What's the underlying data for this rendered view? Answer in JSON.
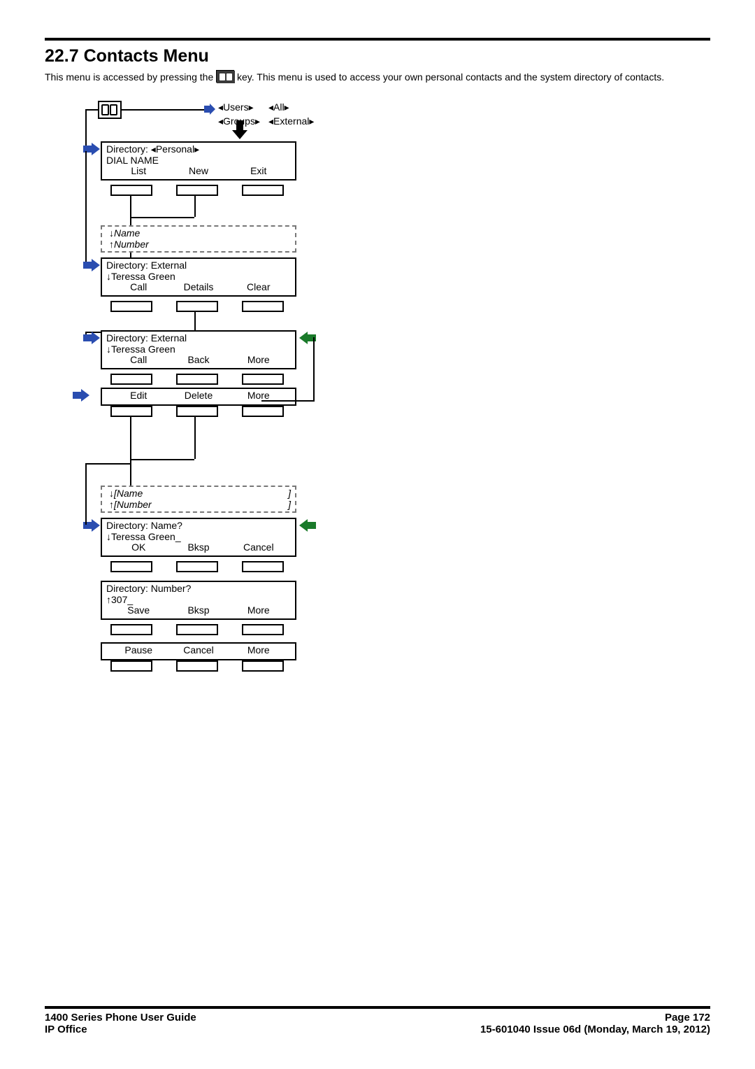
{
  "heading": "22.7 Contacts Menu",
  "intro_before": "This menu is accessed by pressing the ",
  "intro_after": " key. This menu is used to access your own personal contacts and the system directory of contacts.",
  "filters": {
    "users": "◂Users▸",
    "all": "◂All▸",
    "groups": "◂Groups▸",
    "external": "◂External▸"
  },
  "screen1": {
    "title": "Directory: ◂Personal▸",
    "line": "DIAL NAME",
    "soft": [
      "List",
      "New",
      "Exit"
    ]
  },
  "namebox1": {
    "name": "↓Name",
    "number": "↑Number"
  },
  "screen2": {
    "title": "Directory:  External",
    "line": "↓Teressa Green",
    "soft": [
      "Call",
      "Details",
      "Clear"
    ]
  },
  "screen3": {
    "title": "Directory:  External",
    "line": "↓Teressa Green",
    "soft": [
      "Call",
      "Back",
      "More"
    ]
  },
  "screen3b_soft": [
    "Edit",
    "Delete",
    "More"
  ],
  "namebox2": {
    "name": "↓[Name",
    "name_end": "]",
    "number": "↑[Number",
    "number_end": "]"
  },
  "screen4": {
    "title": "Directory: Name?",
    "line": "↓Teressa Green_",
    "soft": [
      "OK",
      "Bksp",
      "Cancel"
    ]
  },
  "screen5": {
    "title": "Directory: Number?",
    "line": "↑307_",
    "soft": [
      "Save",
      "Bksp",
      "More"
    ]
  },
  "screen5b_soft": [
    "Pause",
    "Cancel",
    "More"
  ],
  "footer": {
    "guide": "1400 Series Phone User Guide",
    "page": "Page 172",
    "office": "IP Office",
    "issue": "15-601040 Issue 06d (Monday, March 19, 2012)"
  }
}
